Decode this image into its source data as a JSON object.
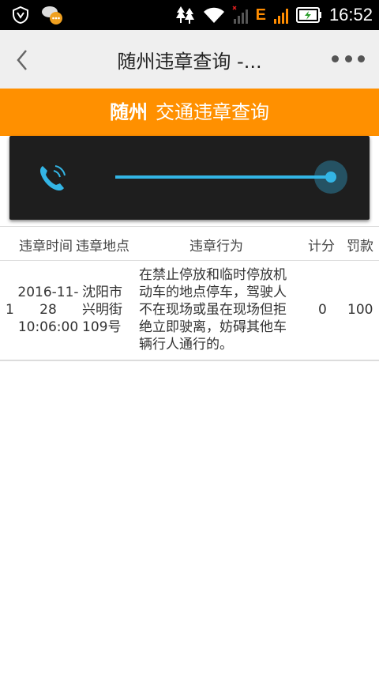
{
  "status_bar": {
    "time": "16:52",
    "network_type": "E",
    "icons": [
      "shield-icon",
      "chat-notification-icon",
      "trees-icon",
      "wifi-icon",
      "signal-off-icon",
      "signal-icon",
      "battery-charging-icon"
    ]
  },
  "appbar": {
    "title": "随州违章查询 -...",
    "back_icon": "chevron-left-icon",
    "more_icon": "overflow-menu-icon"
  },
  "banner": {
    "city": "随州",
    "text": "交通违章查询"
  },
  "volume_overlay": {
    "icon": "phone-volume-icon",
    "level": 1.0,
    "accent_color": "#33b5e5"
  },
  "table": {
    "headers": [
      "违章时间",
      "违章地点",
      "违章行为",
      "计分",
      "罚款"
    ],
    "rows": [
      {
        "index": "1",
        "time_lines": [
          "2016-11-",
          "28",
          "10:06:00"
        ],
        "place_lines": [
          "沈阳市",
          "兴明街",
          "109号"
        ],
        "behavior_lines": [
          "在禁止停放和临时停放机",
          "动车的地点停车，驾驶人",
          "不在现场或虽在现场但拒",
          "绝立即驶离，妨碍其他车",
          "辆行人通行的。"
        ],
        "points": "0",
        "fine": "100"
      }
    ]
  },
  "colors": {
    "banner_bg": "#ff9000",
    "appbar_bg": "#efefef",
    "overlay_bg": "#1e1e1e"
  }
}
